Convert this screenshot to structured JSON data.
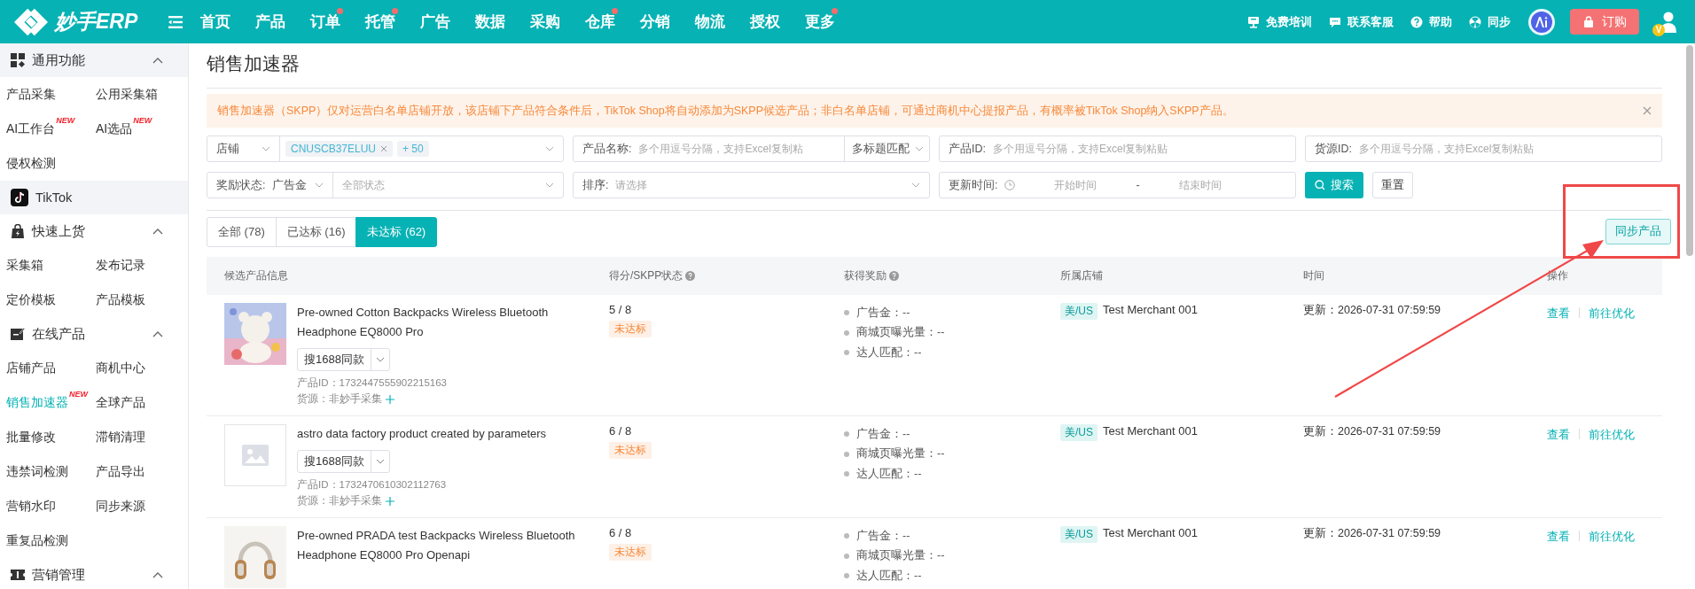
{
  "app": {
    "logo": "妙手ERP"
  },
  "nav": [
    {
      "label": "首页",
      "dot": false
    },
    {
      "label": "产品",
      "dot": false
    },
    {
      "label": "订单",
      "dot": true
    },
    {
      "label": "托管",
      "dot": true
    },
    {
      "label": "广告",
      "dot": false
    },
    {
      "label": "数据",
      "dot": false
    },
    {
      "label": "采购",
      "dot": false
    },
    {
      "label": "仓库",
      "dot": true
    },
    {
      "label": "分销",
      "dot": false
    },
    {
      "label": "物流",
      "dot": false
    },
    {
      "label": "授权",
      "dot": false
    },
    {
      "label": "更多",
      "dot": true
    }
  ],
  "header_actions": [
    {
      "label": "免费培训"
    },
    {
      "label": "联系客服"
    },
    {
      "label": "帮助"
    },
    {
      "label": "同步"
    }
  ],
  "order_button": "订购",
  "avatar_badge": "V",
  "sidebar": {
    "sections": [
      {
        "title": "通用功能",
        "kind": "group",
        "shaded": true,
        "expanded": true,
        "items": [
          {
            "label": "产品采集",
            "selected": false
          },
          {
            "label": "公用采集箱",
            "selected": false
          },
          {
            "label": "AI工作台",
            "badge": "NEW",
            "selected": false
          },
          {
            "label": "AI选品",
            "badge": "NEW",
            "selected": false
          },
          {
            "label": "侵权检测",
            "selected": false
          }
        ]
      },
      {
        "title": "TikTok",
        "kind": "platform",
        "shaded": true
      },
      {
        "title": "快速上货",
        "kind": "group",
        "shaded": false,
        "expanded": true,
        "items": [
          {
            "label": "采集箱",
            "selected": false
          },
          {
            "label": "发布记录",
            "selected": false
          },
          {
            "label": "定价模板",
            "selected": false
          },
          {
            "label": "产品模板",
            "selected": false
          }
        ]
      },
      {
        "title": "在线产品",
        "kind": "group",
        "shaded": false,
        "expanded": true,
        "items": [
          {
            "label": "店铺产品",
            "selected": false
          },
          {
            "label": "商机中心",
            "selected": false
          },
          {
            "label": "销售加速器",
            "badge": "NEW",
            "selected": true
          },
          {
            "label": "全球产品",
            "selected": false
          },
          {
            "label": "批量修改",
            "selected": false
          },
          {
            "label": "滞销清理",
            "selected": false
          },
          {
            "label": "违禁词检测",
            "selected": false
          },
          {
            "label": "产品导出",
            "selected": false
          },
          {
            "label": "营销水印",
            "selected": false
          },
          {
            "label": "同步来源",
            "selected": false
          },
          {
            "label": "重复品检测",
            "selected": false
          }
        ]
      },
      {
        "title": "营销管理",
        "kind": "group",
        "shaded": false,
        "expanded": true
      }
    ]
  },
  "page": {
    "title": "销售加速器",
    "alert": "销售加速器（SKPP）仅对运营白名单店铺开放，该店铺下产品符合条件后，TikTok Shop将自动添加为SKPP候选产品；非白名单店铺，可通过商机中心提报产品，有概率被TikTok Shop纳入SKPP产品。",
    "filters": {
      "shop": {
        "label": "店铺",
        "tags": [
          "CNUSCB37ELUU",
          "+ 50"
        ]
      },
      "product_name": {
        "label": "产品名称:",
        "placeholder": "多个用逗号分隔，支持Excel复制粘",
        "mode": "多标题匹配"
      },
      "product_id": {
        "label": "产品ID:",
        "placeholder": "多个用逗号分隔，支持Excel复制粘贴"
      },
      "source_id": {
        "label": "货源ID:",
        "placeholder": "多个用逗号分隔，支持Excel复制粘贴"
      },
      "reward_status": {
        "label": "奖励状态:",
        "value": "广告金",
        "placeholder": "全部状态"
      },
      "sort": {
        "label": "排序:",
        "placeholder": "请选择"
      },
      "update_time": {
        "label": "更新时间:",
        "start_placeholder": "开始时间",
        "separator": "-",
        "end_placeholder": "结束时间"
      },
      "search_button": "搜索",
      "reset_button": "重置"
    },
    "tabs": [
      {
        "label": "全部 (78)",
        "selected": false
      },
      {
        "label": "已达标 (16)",
        "selected": false
      },
      {
        "label": "未达标 (62)",
        "selected": true
      }
    ],
    "sync_button": "同步产品",
    "table": {
      "columns": [
        {
          "label": "候选产品信息",
          "help": false
        },
        {
          "label": "得分/SKPP状态",
          "help": true
        },
        {
          "label": "获得奖励",
          "help": true
        },
        {
          "label": "所属店铺",
          "help": false
        },
        {
          "label": "时间",
          "help": false
        },
        {
          "label": "操作",
          "help": false
        }
      ],
      "rows": [
        {
          "image": {
            "kind": "picture"
          },
          "title": "Pre-owned Cotton Backpacks Wireless Bluetooth Headphone EQ8000 Pro",
          "search_button": "搜1688同款",
          "product_id": "产品ID：1732447555902215163",
          "source": "货源：非妙手采集",
          "score": "5 / 8",
          "status": "未达标",
          "rewards": [
            "广告金：--",
            "商城页曝光量：--",
            "达人匹配：--"
          ],
          "region": "美/US",
          "store": "Test Merchant 001",
          "time": "更新：2026-07-31 07:59:59",
          "actions": [
            "查看",
            "前往优化"
          ]
        },
        {
          "image": {
            "kind": "placeholder"
          },
          "title": "astro data factory product created by parameters",
          "search_button": "搜1688同款",
          "product_id": "产品ID：1732470610302112763",
          "source": "货源：非妙手采集",
          "score": "6 / 8",
          "status": "未达标",
          "rewards": [
            "广告金：--",
            "商城页曝光量：--",
            "达人匹配：--"
          ],
          "region": "美/US",
          "store": "Test Merchant 001",
          "time": "更新：2026-07-31 07:59:59",
          "actions": [
            "查看",
            "前往优化"
          ]
        },
        {
          "image": {
            "kind": "picture"
          },
          "title": "Pre-owned PRADA test Backpacks Wireless Bluetooth Headphone EQ8000 Pro Openapi",
          "score": "6 / 8",
          "status": "未达标",
          "rewards": [
            "广告金：--",
            "商城页曝光量：--",
            "达人匹配：--"
          ],
          "region": "美/US",
          "store": "Test Merchant 001",
          "time": "更新：2026-07-31 07:59:59",
          "actions": [
            "查看",
            "前往优化"
          ]
        }
      ]
    }
  },
  "annotation": {
    "highlight": true,
    "arrow": true
  }
}
